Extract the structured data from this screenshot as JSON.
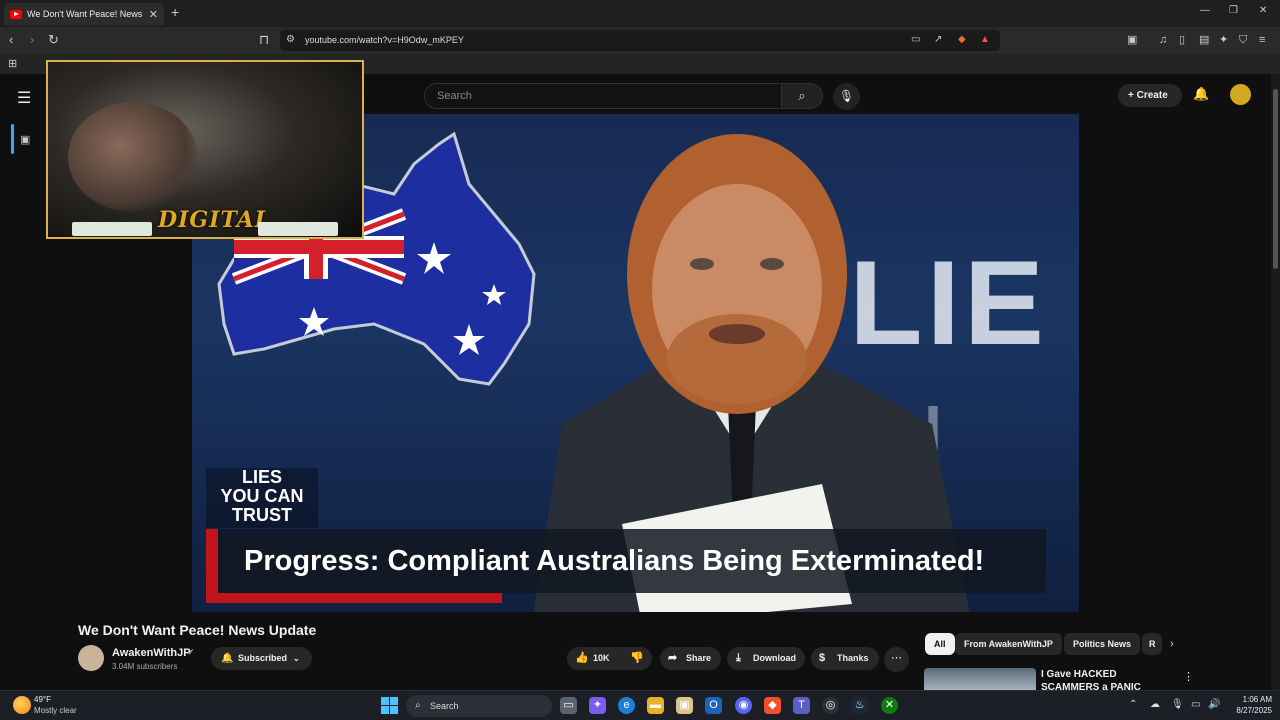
{
  "browser": {
    "tab_title": "We Don't Want Peace! News",
    "url": "youtube.com/watch?v=H9Odw_mKPEY"
  },
  "youtube": {
    "search_placeholder": "Search",
    "create_label": "Create"
  },
  "video": {
    "overlay_logo": [
      "LIES",
      "YOU CAN",
      "TRUST"
    ],
    "caption": "Progress: Compliant Australians Being Exterminated!",
    "background_text_1": "WLIE",
    "background_text_2": "TU",
    "pip_label": "DIGITAL"
  },
  "meta": {
    "title": "We Don't Want Peace! News Update",
    "channel_name": "AwakenWithJP",
    "subscribers": "3.04M subscribers",
    "subscribed_label": "Subscribed",
    "like_count": "10K",
    "share_label": "Share",
    "download_label": "Download",
    "thanks_label": "Thanks"
  },
  "chips": [
    "All",
    "From AwakenWithJP",
    "Politics News",
    "R"
  ],
  "recommendation": {
    "title": "I Gave HACKED SCAMMERS a PANIC ATTACK On CCTV!"
  },
  "taskbar": {
    "temperature": "49°F",
    "condition": "Mostly clear",
    "search_label": "Search",
    "time": "1:06 AM",
    "date": "8/27/2025"
  },
  "colors": {
    "accent_red": "#c0151a",
    "youtube_red": "#ff0000",
    "link_blue": "#3ea6ff"
  }
}
